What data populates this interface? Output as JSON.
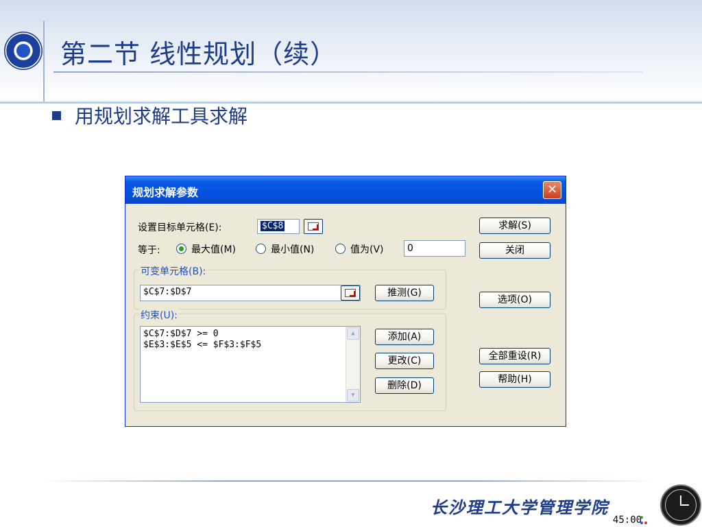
{
  "slide": {
    "title": "第二节  线性规划（续）",
    "bullet": "用规划求解工具求解",
    "footer": "长沙理工大学管理学院",
    "timer": "45:00"
  },
  "dialog": {
    "title": "规划求解参数",
    "close_glyph": "✕",
    "target_label": "设置目标单元格(E):",
    "target_value": "$C$8",
    "equal_label": "等于:",
    "options": [
      {
        "label": "最大值(M)",
        "selected": true
      },
      {
        "label": "最小值(N)",
        "selected": false
      },
      {
        "label": "值为(V)",
        "selected": false
      }
    ],
    "value_field": "0",
    "changing_label": "可变单元格(B):",
    "changing_value": "$C$7:$D$7",
    "constraints_label": "约束(U):",
    "constraints": [
      "$C$7:$D$7 >= 0",
      "$E$3:$E$5 <= $F$3:$F$5"
    ],
    "buttons": {
      "solve": "求解(S)",
      "close": "关闭",
      "guess": "推测(G)",
      "options": "选项(O)",
      "add": "添加(A)",
      "change": "更改(C)",
      "delete": "删除(D)",
      "reset_all": "全部重设(R)",
      "help": "帮助(H)"
    }
  },
  "colors": {
    "title_blue": "#1d3c8a",
    "dialog_titlebar": "#0450e0",
    "dialog_face": "#ece9d8"
  }
}
